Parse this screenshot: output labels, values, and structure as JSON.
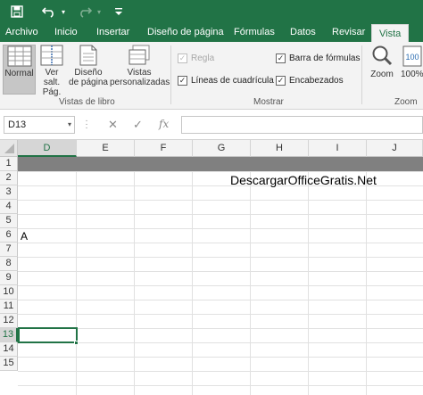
{
  "quick_access": {
    "save_icon": "save-icon",
    "undo_icon": "undo-icon",
    "redo_icon": "redo-icon",
    "customize_icon": "chevron-down-icon"
  },
  "tabs": [
    {
      "label": "Archivo"
    },
    {
      "label": "Inicio"
    },
    {
      "label": "Insertar"
    },
    {
      "label": "Diseño de página"
    },
    {
      "label": "Fórmulas"
    },
    {
      "label": "Datos"
    },
    {
      "label": "Revisar"
    },
    {
      "label": "Vista",
      "active": true
    }
  ],
  "ribbon": {
    "vistas_libro": {
      "normal": "Normal",
      "salto_line1": "Ver salt.",
      "salto_line2": "Pág.",
      "diseno_line1": "Diseño",
      "diseno_line2": "de página",
      "personalizadas_line1": "Vistas",
      "personalizadas_line2": "personalizadas",
      "group_label": "Vistas de libro"
    },
    "mostrar": {
      "regla": "Regla",
      "lineas": "Líneas de cuadrícula",
      "barra": "Barra de fórmulas",
      "encabezados": "Encabezados",
      "group_label": "Mostrar"
    },
    "zoom": {
      "zoom": "Zoom",
      "zoom100": "100%",
      "group_label": "Zoom"
    }
  },
  "formula_bar": {
    "name_box": "D13",
    "cancel_icon": "✕",
    "enter_icon": "✓",
    "fx_icon": "fx",
    "formula": ""
  },
  "sheet": {
    "columns": [
      "D",
      "E",
      "F",
      "G",
      "H",
      "I",
      "J"
    ],
    "rows": [
      "1",
      "2",
      "3",
      "4",
      "5",
      "6",
      "7",
      "8",
      "9",
      "10",
      "11",
      "12",
      "13",
      "14",
      "15"
    ],
    "selected_column": "D",
    "selected_row": "13",
    "cells": {
      "G2": "DescargarOfficeGratis.Net",
      "D6": "A"
    }
  }
}
